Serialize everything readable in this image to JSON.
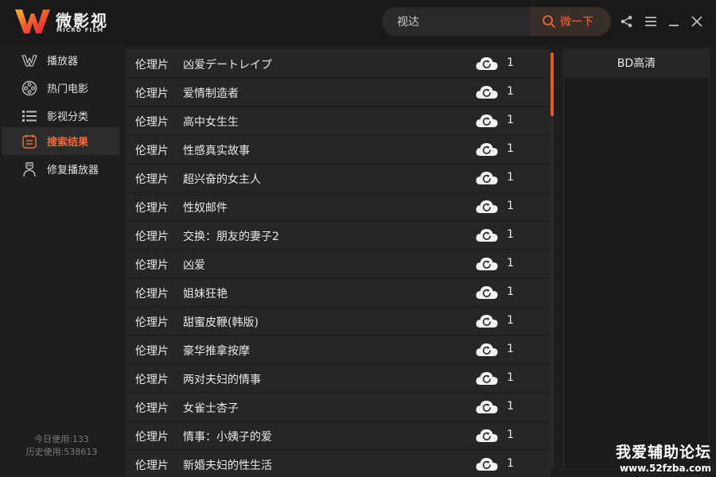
{
  "app": {
    "logo_cn": "微影视",
    "logo_en": "MICRO FILM"
  },
  "search": {
    "value": "视达",
    "button_label": "微一下"
  },
  "sidebar": {
    "items": [
      {
        "label": "播放器",
        "icon": "w-logo-icon",
        "active": false
      },
      {
        "label": "热门电影",
        "icon": "film-reel-icon",
        "active": false
      },
      {
        "label": "影视分类",
        "icon": "list-icon",
        "active": false
      },
      {
        "label": "搜索结果",
        "icon": "search-results-icon",
        "active": true
      },
      {
        "label": "修复播放器",
        "icon": "repair-icon",
        "active": false
      }
    ],
    "usage_today": "今日使用:133",
    "usage_history": "历史使用:538613"
  },
  "results": [
    {
      "category": "伦理片",
      "title": "凶爱デートレイプ",
      "count": "1"
    },
    {
      "category": "伦理片",
      "title": "爱情制造者",
      "count": "1"
    },
    {
      "category": "伦理片",
      "title": "高中女生生",
      "count": "1"
    },
    {
      "category": "伦理片",
      "title": "性感真实故事",
      "count": "1"
    },
    {
      "category": "伦理片",
      "title": "超兴奋的女主人",
      "count": "1"
    },
    {
      "category": "伦理片",
      "title": "性奴邮件",
      "count": "1"
    },
    {
      "category": "伦理片",
      "title": "交换：朋友的妻子2",
      "count": "1"
    },
    {
      "category": "伦理片",
      "title": "凶爱",
      "count": "1"
    },
    {
      "category": "伦理片",
      "title": "姐妹狂艳",
      "count": "1"
    },
    {
      "category": "伦理片",
      "title": "甜蜜皮鞭(韩版)",
      "count": "1"
    },
    {
      "category": "伦理片",
      "title": "豪华推拿按摩",
      "count": "1"
    },
    {
      "category": "伦理片",
      "title": "两对夫妇的情事",
      "count": "1"
    },
    {
      "category": "伦理片",
      "title": "女雀士杏子",
      "count": "1"
    },
    {
      "category": "伦理片",
      "title": "情事：小姨子的爱",
      "count": "1"
    },
    {
      "category": "伦理片",
      "title": "新婚夫妇的性生活",
      "count": "1"
    }
  ],
  "quality": {
    "label": "BD高清"
  },
  "watermark": {
    "cn": "我爱辅助论坛",
    "url": "www.52fzba.com"
  },
  "colors": {
    "accent": "#f06a3a",
    "background": "#1e1e1e",
    "row": "#262626"
  }
}
